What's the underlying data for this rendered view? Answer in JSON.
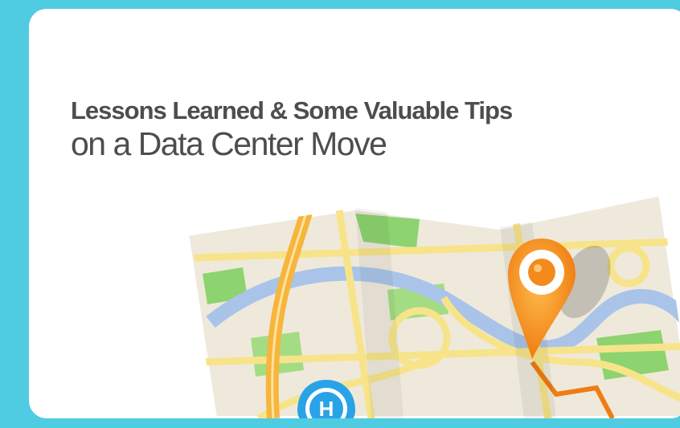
{
  "headline": {
    "line1": "Lessons Learned & Some Valuable Tips",
    "line2": "on a Data Center Move"
  },
  "illustration": {
    "hospital_marker_letter": "H"
  },
  "colors": {
    "background": "#4fcbe2",
    "card": "#ffffff",
    "text": "#4d4d4d",
    "map_base": "#efe9dc",
    "road_yellow": "#f7e48a",
    "road_orange": "#f6b53c",
    "river_blue": "#a9c4e8",
    "park_green": "#8dd36f",
    "pin_orange": "#f28a1e",
    "marker_blue": "#2aa3e6"
  }
}
